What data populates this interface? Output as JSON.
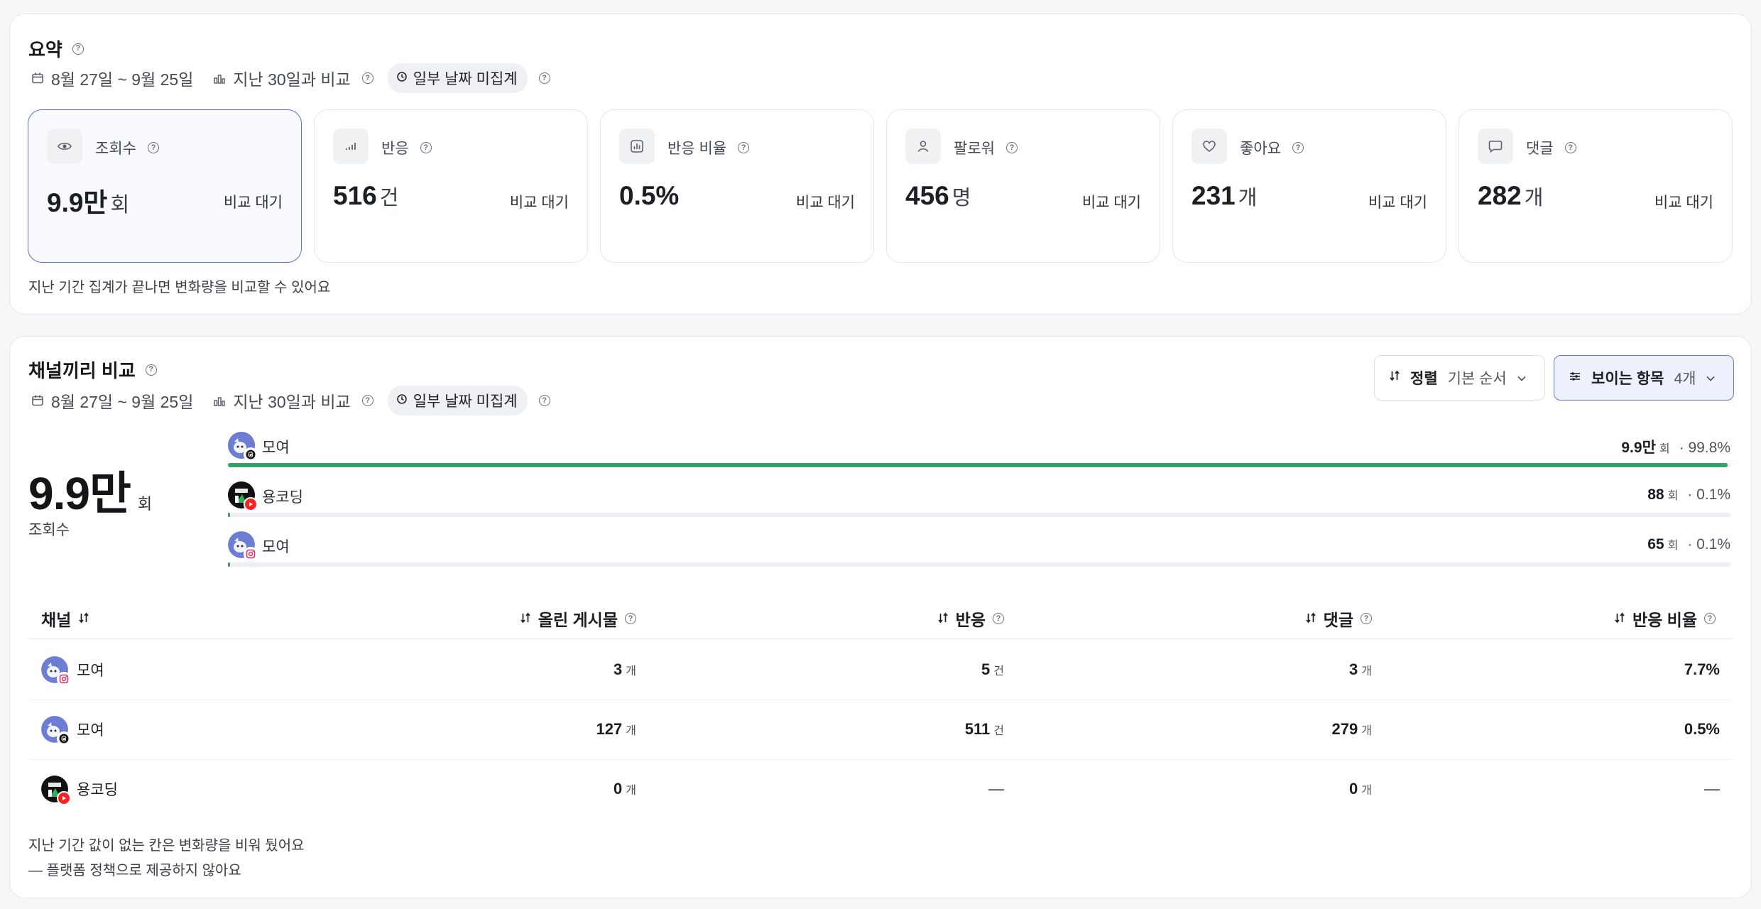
{
  "summary": {
    "title": "요약",
    "date_range": "8월 27일 ~ 9월 25일",
    "compare_period": "지난 30일과 비교",
    "pill_label": "일부 날짜 미집계",
    "metrics": [
      {
        "label": "조회수",
        "value": "9.9만",
        "unit": "회",
        "compare": "비교 대기",
        "icon": "eye-icon"
      },
      {
        "label": "반응",
        "value": "516",
        "unit": "건",
        "compare": "비교 대기",
        "icon": "signal-bars-icon"
      },
      {
        "label": "반응 비율",
        "value": "0.5%",
        "unit": "",
        "compare": "비교 대기",
        "icon": "bar-chart-icon"
      },
      {
        "label": "팔로워",
        "value": "456",
        "unit": "명",
        "compare": "비교 대기",
        "icon": "person-icon"
      },
      {
        "label": "좋아요",
        "value": "231",
        "unit": "개",
        "compare": "비교 대기",
        "icon": "heart-icon"
      },
      {
        "label": "댓글",
        "value": "282",
        "unit": "개",
        "compare": "비교 대기",
        "icon": "comment-icon"
      }
    ],
    "note": "지난 기간 집계가 끝나면 변화량을 비교할 수 있어요"
  },
  "compare": {
    "title": "채널끼리 비교",
    "date_range": "8월 27일 ~ 9월 25일",
    "compare_period": "지난 30일과 비교",
    "pill_label": "일부 날짜 미집계",
    "sort": {
      "label": "정렬",
      "value": "기본 순서"
    },
    "visible": {
      "label": "보이는 항목",
      "value": "4개"
    },
    "total_value": "9.9만",
    "total_unit": "회",
    "total_label": "조회수",
    "bars": [
      {
        "name": "모여",
        "platform": "threads",
        "value": "9.9만",
        "unit": "회",
        "pct": "· 99.8%",
        "share": 0.998
      },
      {
        "name": "용코딩",
        "platform": "youtube",
        "value": "88",
        "unit": "회",
        "pct": "· 0.1%",
        "share": 0.001
      },
      {
        "name": "모여",
        "platform": "instagram",
        "value": "65",
        "unit": "회",
        "pct": "· 0.1%",
        "share": 0.001
      }
    ],
    "table": {
      "headers": {
        "channel": "채널",
        "posts": "올린 게시물",
        "reactions": "반응",
        "comments": "댓글",
        "rate": "반응 비율"
      },
      "rows": [
        {
          "name": "모여",
          "platform": "instagram",
          "posts": "3",
          "posts_unit": "개",
          "reactions": "5",
          "reactions_unit": "건",
          "comments": "3",
          "comments_unit": "개",
          "rate": "7.7%"
        },
        {
          "name": "모여",
          "platform": "threads",
          "posts": "127",
          "posts_unit": "개",
          "reactions": "511",
          "reactions_unit": "건",
          "comments": "279",
          "comments_unit": "개",
          "rate": "0.5%"
        },
        {
          "name": "용코딩",
          "platform": "youtube",
          "posts": "0",
          "posts_unit": "개",
          "reactions": "—",
          "reactions_unit": "",
          "comments": "0",
          "comments_unit": "개",
          "rate": "—"
        }
      ]
    },
    "footnote1": "지난 기간 값이 없는 칸은 변화량을 비워 뒀어요",
    "footnote2": "— 플랫폼 정책으로 제공하지 않아요"
  }
}
